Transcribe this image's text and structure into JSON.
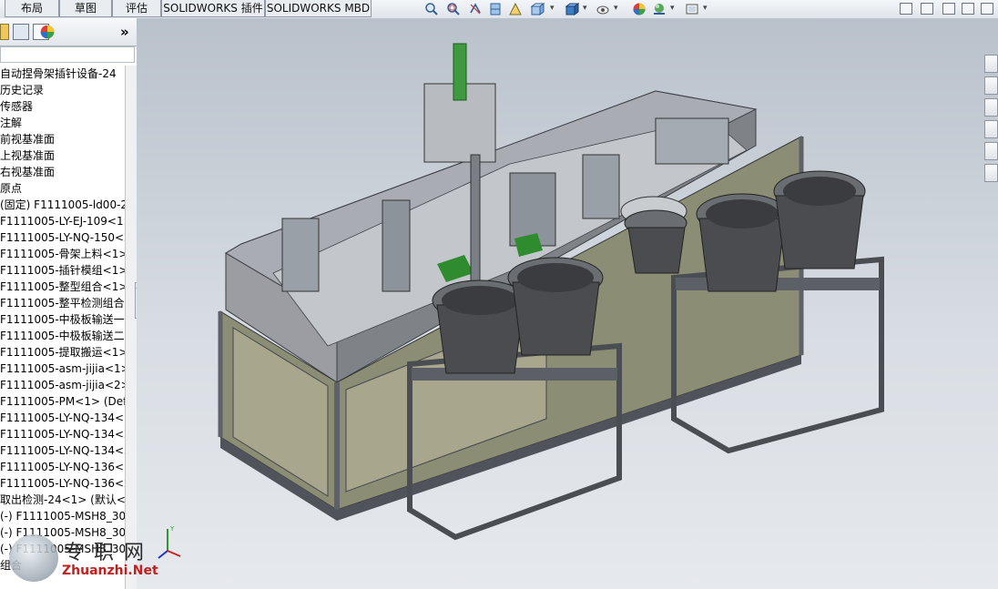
{
  "tabs": [
    "布局",
    "草图",
    "评估",
    "SOLIDWORKS 插件",
    "SOLIDWORKS MBD"
  ],
  "toolbar_icons": [
    "zoom-to-fit-icon",
    "zoom-area-icon",
    "previous-view-icon",
    "section-view-icon",
    "dynamic-annotation-icon",
    "view-orientation-icon",
    "display-style-icon",
    "hide-show-icon",
    "edit-appearance-icon",
    "apply-scene-icon",
    "view-settings-icon"
  ],
  "left_panel": {
    "tabs_icons": [
      "feature-manager-icon",
      "property-manager-icon",
      "configuration-manager-icon",
      "appearance-icon"
    ],
    "expand_label": "»",
    "tree_items": [
      "自动捏骨架插针设备-24",
      "历史记录",
      "传感器",
      "注解",
      "前视基准面",
      "上视基准面",
      "右视基准面",
      "原点",
      "(固定) F1111005-ld00-2<",
      "F1111005-LY-EJ-109<1>",
      "F1111005-LY-NQ-150<2",
      "F1111005-骨架上料<1> (",
      "F1111005-插针模组<1> (",
      "F1111005-整型组合<1> (",
      "F1111005-整平检测组合<",
      "F1111005-中极板输送一<",
      "F1111005-中极板输送二<",
      "F1111005-提取搬运<1> (",
      "F1111005-asm-jijia<1> (",
      "F1111005-asm-jijia<2> (",
      "F1111005-PM<1> (Defa",
      "F1111005-LY-NQ-134<1",
      "F1111005-LY-NQ-134<2",
      "F1111005-LY-NQ-134<3",
      "F1111005-LY-NQ-136<1",
      "F1111005-LY-NQ-136<2",
      "取出检测-24<1> (默认<显",
      "(-) F1111005-MSH8_30<",
      "(-) F1111005-MSH8_30<",
      "(-) F1111005-MSH8_30<",
      "组合"
    ]
  },
  "right_taskpane_icons": [
    "home-icon",
    "design-library-icon",
    "file-explorer-icon",
    "view-palette-icon",
    "appearance-scenes-icon",
    "custom-properties-icon"
  ],
  "watermark": {
    "cn": "专 职 网",
    "en": "Zhuanzhi.Net"
  },
  "colors": {
    "viewport_top": "#b9c1cb",
    "machine_panel": "#8b8d74",
    "frame": "#5e6268",
    "bowl": "#4a4c50",
    "accent_green": "#2e8b2e"
  }
}
